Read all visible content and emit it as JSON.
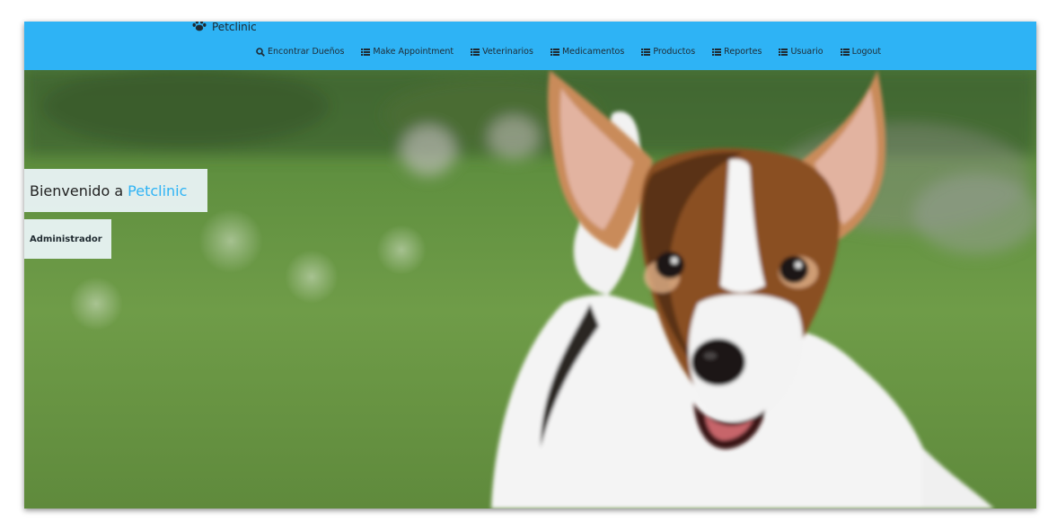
{
  "brand": {
    "name": "Petclinic",
    "icon": "paw-icon"
  },
  "nav": [
    {
      "label": "Encontrar Dueños",
      "icon": "search-icon"
    },
    {
      "label": "Make Appointment",
      "icon": "list-icon"
    },
    {
      "label": "Veterinarios",
      "icon": "list-icon"
    },
    {
      "label": "Medicamentos",
      "icon": "list-icon"
    },
    {
      "label": "Productos",
      "icon": "list-icon"
    },
    {
      "label": "Reportes",
      "icon": "list-icon"
    },
    {
      "label": "Usuario",
      "icon": "list-icon"
    },
    {
      "label": "Logout",
      "icon": "list-icon"
    }
  ],
  "hero": {
    "welcome_prefix": "Bienvenido a",
    "welcome_brand": "Petclinic",
    "role": "Administrador"
  },
  "colors": {
    "navbar": "#2eb3f5",
    "accent": "#2eb3f5",
    "panel": "#e9f3f6"
  }
}
